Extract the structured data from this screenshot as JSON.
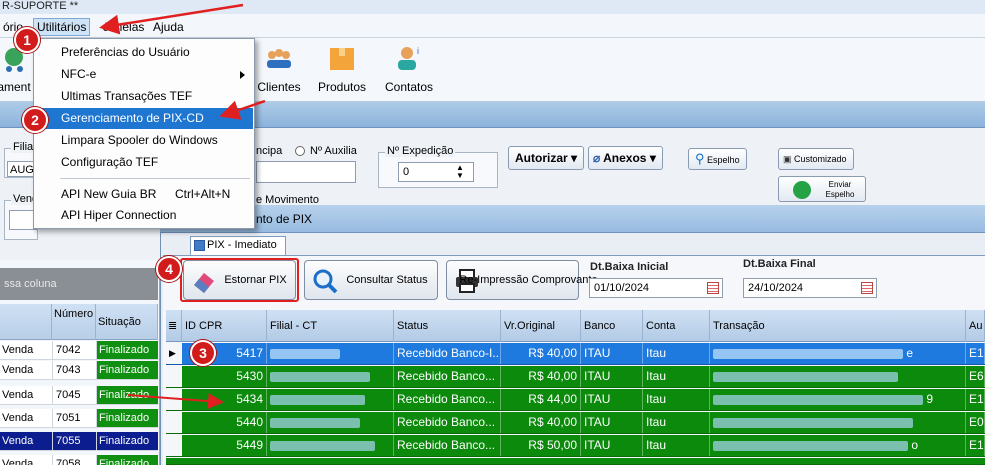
{
  "window": {
    "title": "R-SUPORTE **"
  },
  "menubar": {
    "items": [
      "ório",
      "Utilitários",
      "Janelas",
      "Ajuda"
    ]
  },
  "ribbon": {
    "buttons": [
      "ament",
      "Clientes",
      "Produtos",
      "Contatos"
    ]
  },
  "dropdown": {
    "items": [
      {
        "label": "Preferências do Usuário"
      },
      {
        "label": "NFC-e"
      },
      {
        "label": "Ultimas Transações TEF"
      },
      {
        "label": "Gerenciamento de PIX-CD"
      },
      {
        "label": "Limpara Spooler do Windows"
      },
      {
        "label": "Configuração TEF"
      },
      {
        "label": "API New Guia BR"
      },
      {
        "label": "API Hiper Connection"
      }
    ],
    "shortcut": "Ctrl+Alt+N"
  },
  "form": {
    "filial_label": "Filial",
    "filial_value": "AUG",
    "vendedor_label": "Vend",
    "principal_label": "ncipa",
    "auxiliar_label": "Nº Auxilia",
    "expedicao_label": "Nº Expedição",
    "expedicao_value": "0",
    "movimento_label": "e Movimento",
    "autorizar_label": "Autorizar",
    "anexos_label": "Anexos",
    "espelho_label": "Espelho",
    "customizado_label": "Customizado",
    "enviar_espelho_label": "Enviar Espelho"
  },
  "left_panel": {
    "group_text": "ssa coluna",
    "columns": [
      "",
      "Número",
      "Situação"
    ],
    "rows": [
      {
        "tipo": "Venda",
        "numero": "7042",
        "situacao": "Finalizado"
      },
      {
        "tipo": "Venda",
        "numero": "7043",
        "situacao": "Finalizado"
      },
      {
        "tipo": "Venda",
        "numero": "7045",
        "situacao": "Finalizado"
      },
      {
        "tipo": "Venda",
        "numero": "7051",
        "situacao": "Finalizado"
      },
      {
        "tipo": "Venda",
        "numero": "7055",
        "situacao": "Finalizado"
      },
      {
        "tipo": "Venda",
        "numero": "7058",
        "situacao": "Finalizado"
      }
    ]
  },
  "pix_window": {
    "title": "nto de PIX",
    "tab": "PIX - Imediato",
    "estornar_label": "Estornar PIX",
    "consultar_label": "Consultar Status",
    "reimpressao_label": "Re-Impressão Comprovante",
    "dt_inicial_label": "Dt.Baixa Inicial",
    "dt_inicial_value": "01/10/2024",
    "dt_final_label": "Dt.Baixa Final",
    "dt_final_value": "24/10/2024",
    "columns": [
      "ID CPR",
      "Filial - CT",
      "Status",
      "Vr.Original",
      "Banco",
      "Conta",
      "Transação",
      "Au"
    ],
    "rows": [
      {
        "id": "5417",
        "status": "Recebido Banco-I...",
        "valor": "R$ 40,00",
        "banco": "ITAU",
        "conta": "Itau",
        "tx_end": "e",
        "au": "E1"
      },
      {
        "id": "5430",
        "status": "Recebido Banco...",
        "valor": "R$ 40,00",
        "banco": "ITAU",
        "conta": "Itau",
        "tx_end": "",
        "au": "E6"
      },
      {
        "id": "5434",
        "status": "Recebido Banco...",
        "valor": "R$ 44,00",
        "banco": "ITAU",
        "conta": "Itau",
        "tx_end": "9",
        "au": "E1"
      },
      {
        "id": "5440",
        "status": "Recebido Banco...",
        "valor": "R$ 40,00",
        "banco": "ITAU",
        "conta": "Itau",
        "tx_end": "",
        "au": "E0"
      },
      {
        "id": "5449",
        "status": "Recebido Banco...",
        "valor": "R$ 50,00",
        "banco": "ITAU",
        "conta": "Itau",
        "tx_end": "o",
        "au": "E1"
      }
    ]
  },
  "markers": [
    "1",
    "2",
    "3",
    "4"
  ],
  "colors": {
    "row_green": "#0c8a0c",
    "row_selected": "#1f7ae0",
    "menu_highlight": "#1f76d1",
    "marker_red": "#d21b1b"
  }
}
